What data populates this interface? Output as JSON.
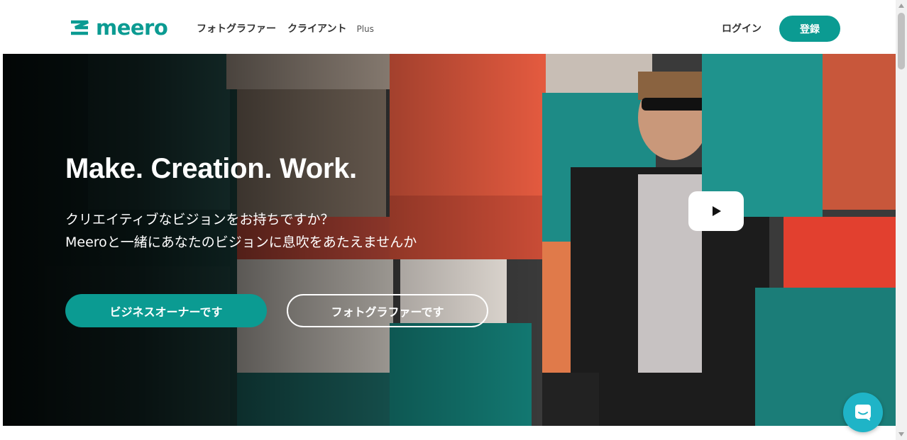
{
  "header": {
    "logo_text": "meero",
    "nav": [
      {
        "label": "フォトグラファー"
      },
      {
        "label": "クライアント"
      },
      {
        "label": "Plus"
      }
    ],
    "login_label": "ログイン",
    "signup_label": "登録"
  },
  "hero": {
    "title": "Make. Creation. Work.",
    "subtitle_line1": "クリエイティブなビジョンをお持ちですか？",
    "subtitle_line2": "Meeroと一緒にあなたのビジョンに息吹をあたえませんか",
    "owner_button": "ビジネスオーナーです",
    "photographer_button": "フォトグラファーです",
    "play_icon": "play-icon"
  },
  "chat": {
    "icon": "chat-icon"
  },
  "colors": {
    "brand": "#0b9b92",
    "chat": "#1fb4c7"
  }
}
